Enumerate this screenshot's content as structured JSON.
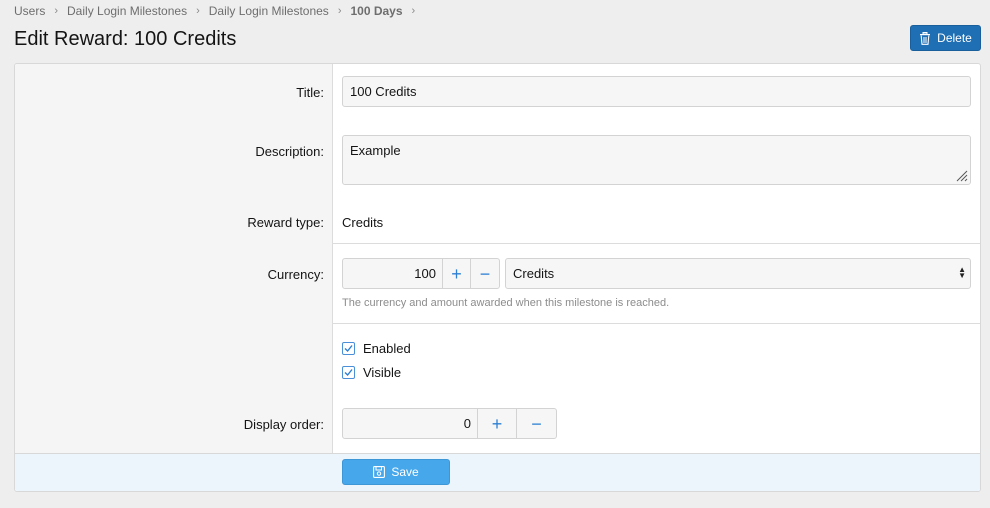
{
  "breadcrumb": {
    "items": [
      "Users",
      "Daily Login Milestones",
      "Daily Login Milestones",
      "100 Days"
    ],
    "separator": "›"
  },
  "header": {
    "title": "Edit Reward: 100 Credits",
    "delete_label": "Delete"
  },
  "form": {
    "title": {
      "label": "Title:",
      "value": "100 Credits"
    },
    "description": {
      "label": "Description:",
      "value": "Example"
    },
    "reward_type": {
      "label": "Reward type:",
      "value": "Credits"
    },
    "currency": {
      "label": "Currency:",
      "amount": "100",
      "plus": "+",
      "minus": "−",
      "selected": "Credits",
      "hint": "The currency and amount awarded when this milestone is reached."
    },
    "options": {
      "enabled": {
        "label": "Enabled",
        "checked": true
      },
      "visible": {
        "label": "Visible",
        "checked": true
      }
    },
    "display_order": {
      "label": "Display order:",
      "value": "0",
      "plus": "+",
      "minus": "−"
    }
  },
  "footer": {
    "save_label": "Save"
  },
  "colors": {
    "accent": "#2c7fd3",
    "delete_bg": "#1f6fb5",
    "save_bg": "#47a7eb",
    "footer_bg": "#edf5fc"
  },
  "icons": {
    "delete": "trash-icon",
    "save": "save-icon",
    "check": "check-icon",
    "breadcrumb_sep": "chevron-right-icon"
  }
}
